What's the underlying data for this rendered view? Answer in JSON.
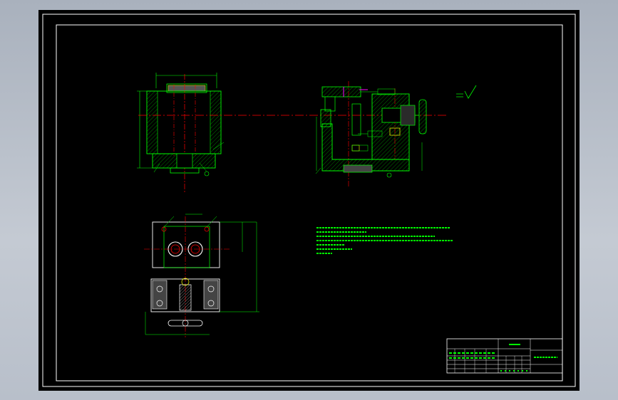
{
  "colors": {
    "background": "#000000",
    "viewer_bg": "#b8bfca",
    "border": "#ffffff",
    "outline": "#00ff00",
    "centerline": "#ff0000",
    "hatch": "#00ff00",
    "dimension": "#00ff00",
    "accent": "#ff00ff",
    "detail": "#ffff00"
  },
  "notes": {
    "lines": [
      "",
      "",
      "",
      "",
      "",
      ""
    ]
  },
  "title_block": {
    "drawing_title": "",
    "drawing_number": "",
    "cells": []
  },
  "surface_finish": {
    "label": ""
  }
}
